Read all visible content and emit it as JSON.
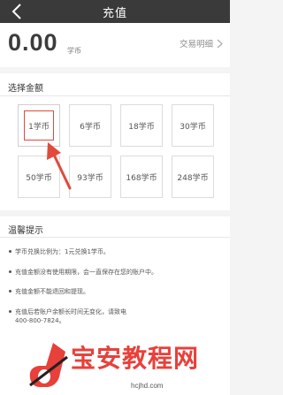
{
  "header": {
    "title": "充值"
  },
  "balance": {
    "amount": "0.00",
    "unit": "学币",
    "detail_label": "交易明细"
  },
  "select_amount": {
    "title": "选择金额",
    "options": [
      "1学币",
      "6学币",
      "18学币",
      "30学币",
      "50学币",
      "93学币",
      "168学币",
      "248学币"
    ],
    "selected_option": "1学币"
  },
  "tips": {
    "title": "温馨提示",
    "items": [
      "学币兑换比例为：1元兑换1学币。",
      "充值金额没有使用期限，会一直保存在您的账户中。",
      "充值金额不能退回和提现。",
      "充值后若账户余额长时间无变化，请致电",
      "400-800-7824。"
    ]
  },
  "watermark": {
    "text": "宝安教程网",
    "url": "hcjhd.com"
  },
  "colors": {
    "topbar": "#3a3a3a",
    "accent_red": "#e04a3a",
    "watermark_red": "#e8403a"
  }
}
